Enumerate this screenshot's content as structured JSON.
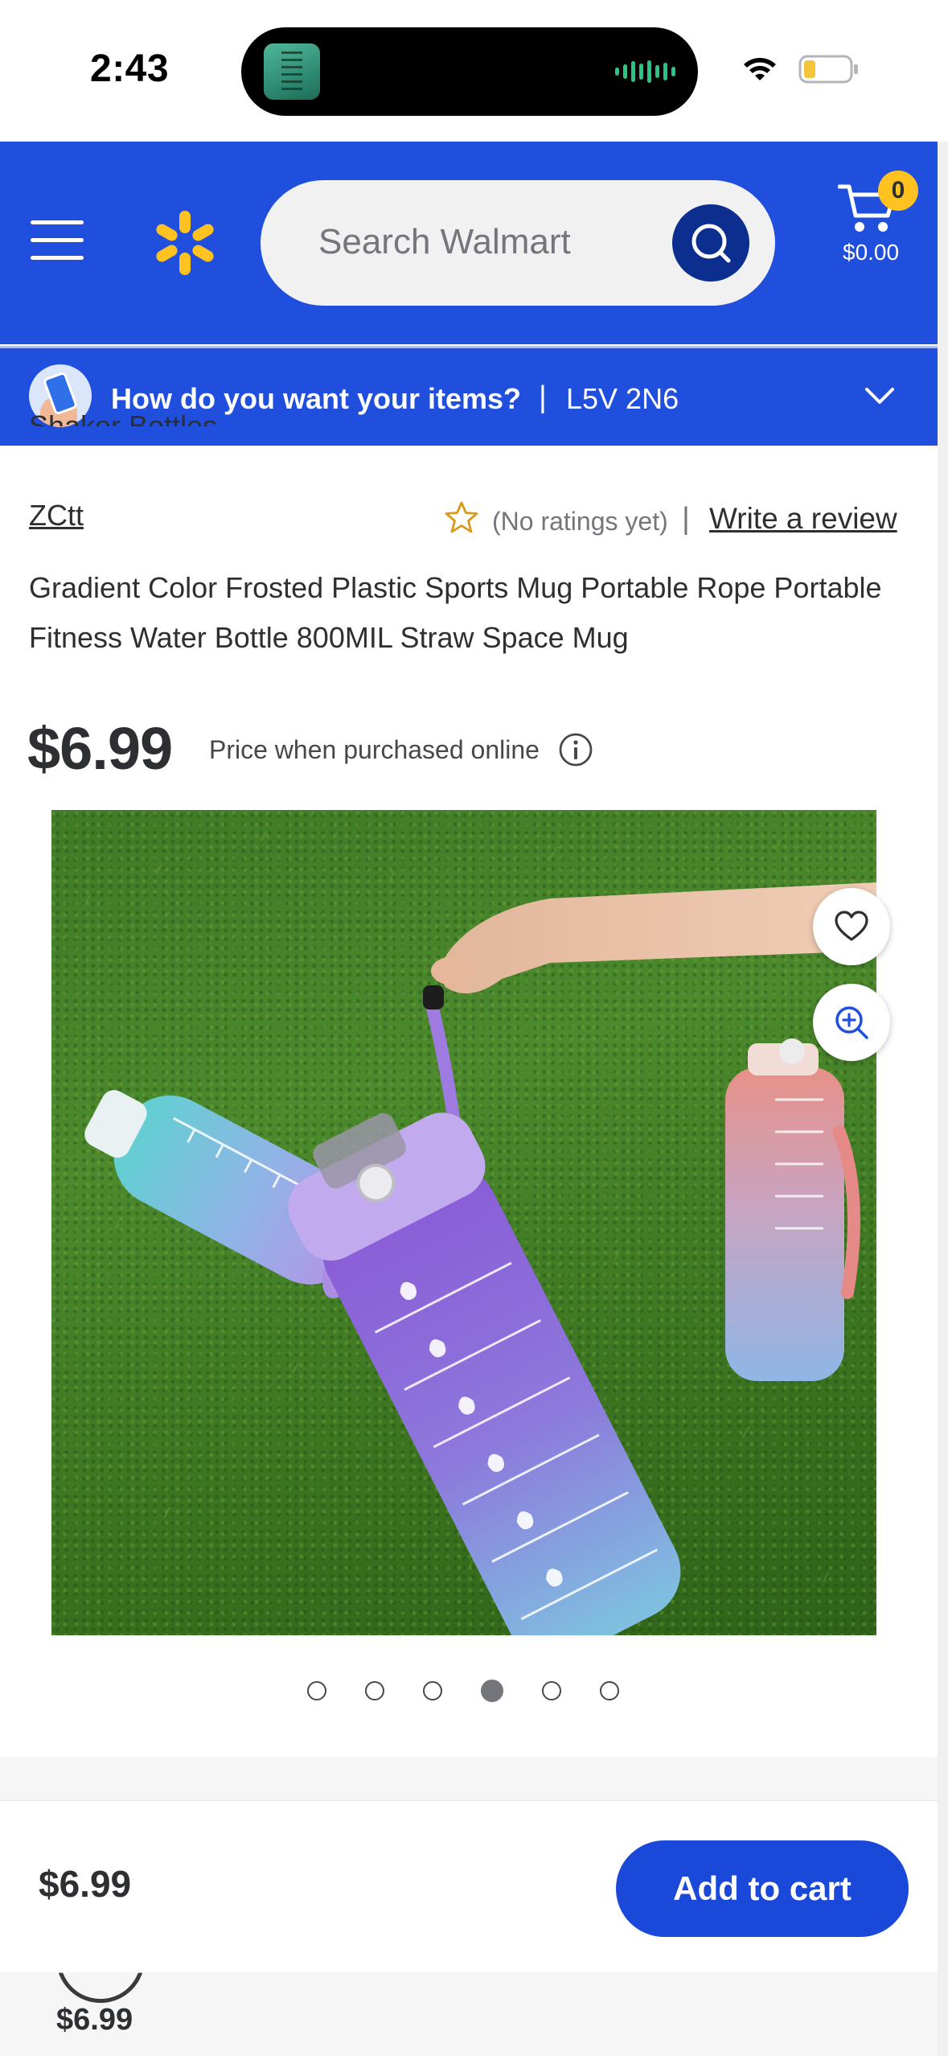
{
  "status_bar": {
    "time": "2:43"
  },
  "header": {
    "search_placeholder": "Search Walmart",
    "cart_count": "0",
    "cart_total": "$0.00",
    "brand_color": "#1f4fdc",
    "spark_color": "#ffc220"
  },
  "location": {
    "question": "How do you want your items?",
    "separator": "|",
    "postal_code": "L5V 2N6"
  },
  "product": {
    "breadcrumb_partial": "Shaker Bottles",
    "brand": "ZCtt",
    "rating_text": "(No ratings yet)",
    "rating_separator": "|",
    "write_review": "Write a review",
    "title": "Gradient Color Frosted Plastic Sports Mug Portable Rope Portable Fitness Water Bottle 800MIL Straw Space Mug",
    "price": "$6.99",
    "price_note": "Price when purchased online"
  },
  "gallery": {
    "image_count": 6,
    "active_index": 3
  },
  "sticky_bar": {
    "price": "$6.99",
    "add_to_cart": "Add to cart"
  },
  "variant": {
    "price": "$6.99"
  }
}
